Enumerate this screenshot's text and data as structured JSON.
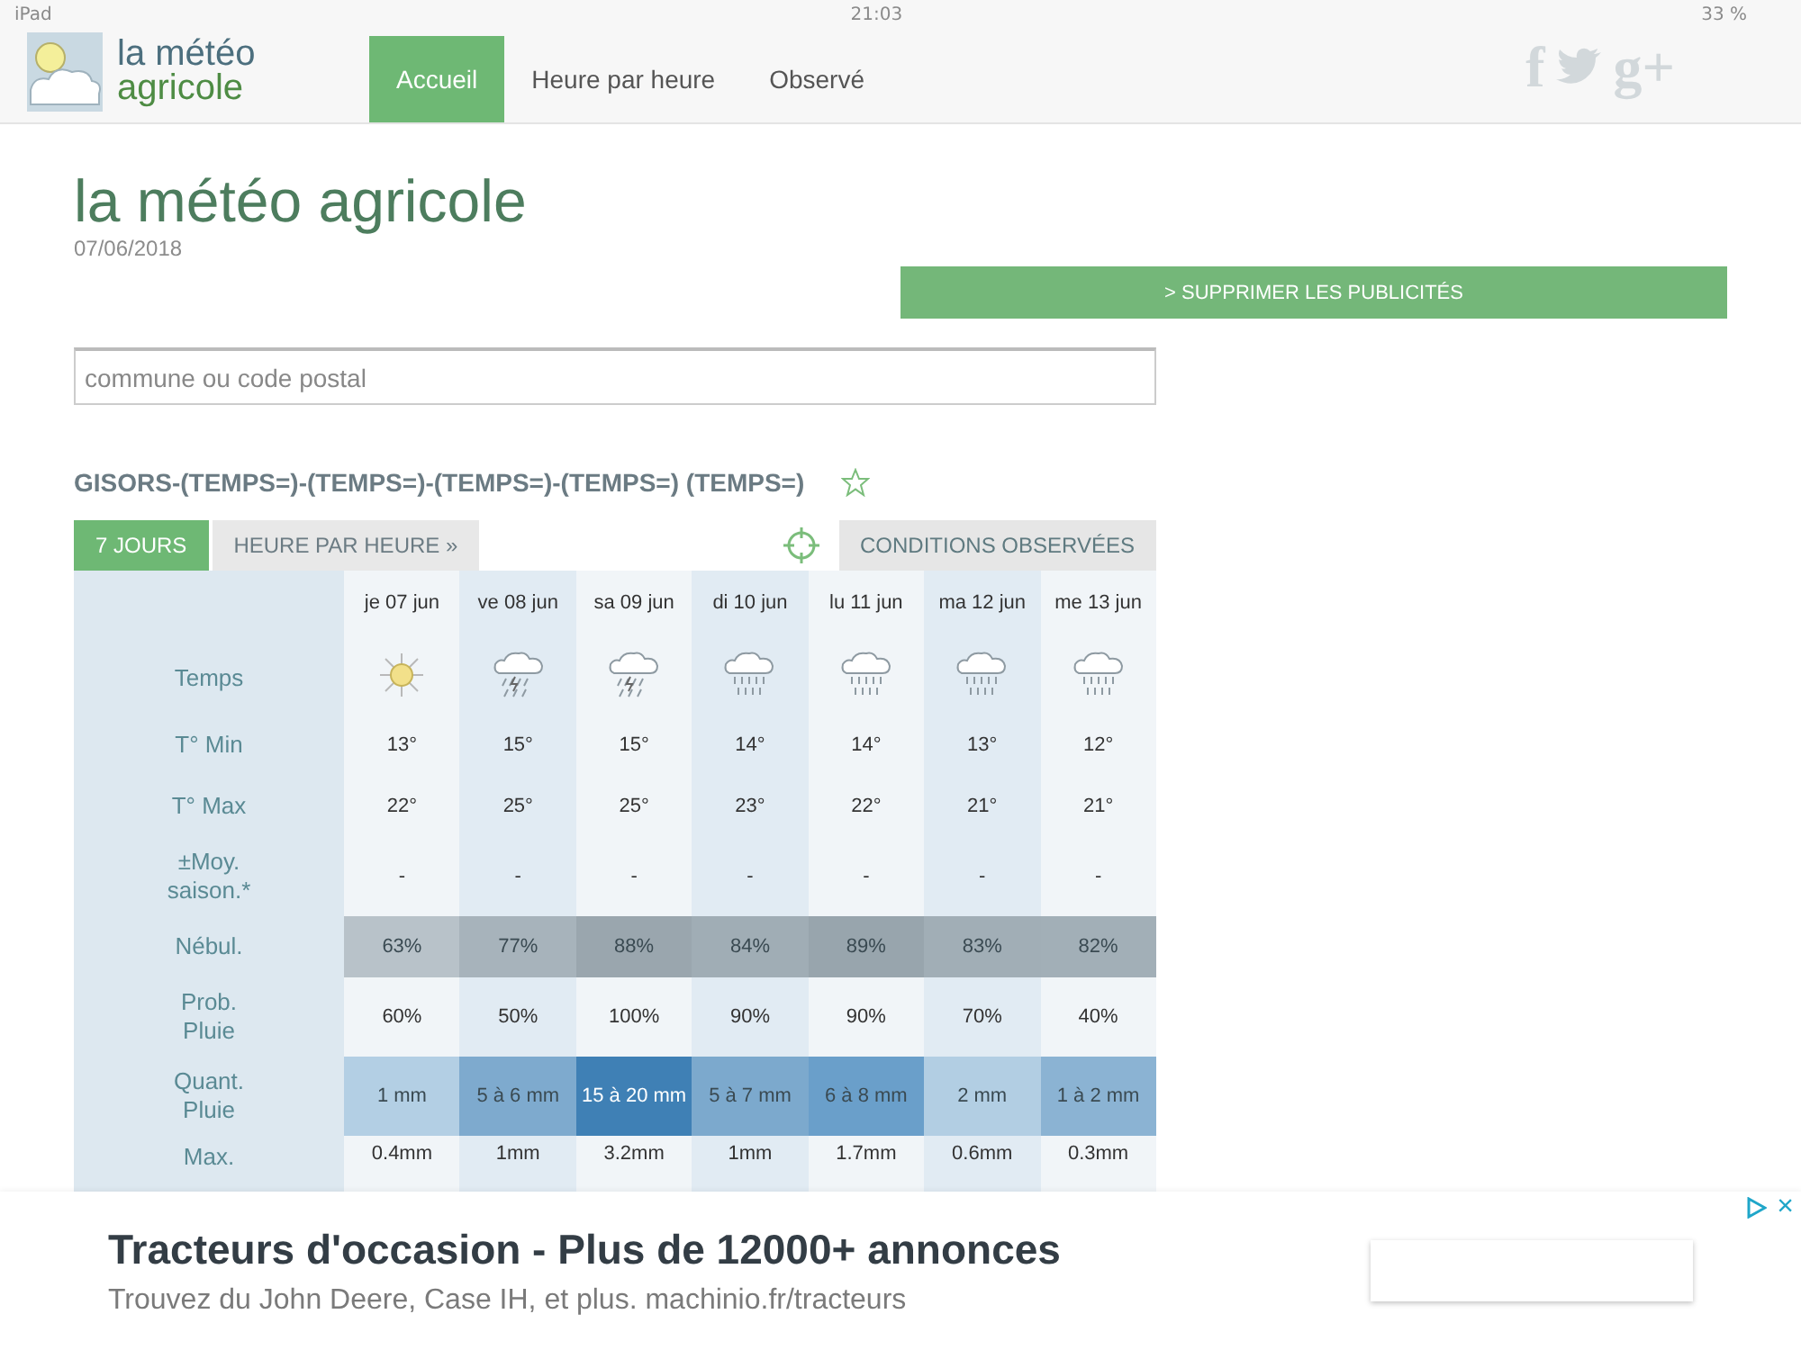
{
  "status_bar": {
    "carrier": "iPad",
    "time": "21:03",
    "battery": "33 %"
  },
  "header": {
    "logo": {
      "line_1": "la météo",
      "line_2": "agricole"
    },
    "nav": [
      {
        "label": "Accueil",
        "selected": true
      },
      {
        "label": "Heure par heure",
        "selected": false
      },
      {
        "label": "Observé",
        "selected": false
      }
    ],
    "social": [
      {
        "kind": "facebook",
        "glyph": "f"
      },
      {
        "kind": "twitter"
      },
      {
        "kind": "google",
        "glyph": "g+"
      }
    ]
  },
  "page": {
    "title": "la météo agricole",
    "date": "07/06/2018",
    "remove_ads_button": "> SUPPRIMER LES PUBLICITÉS",
    "search": {
      "placeholder": "commune ou code postal"
    }
  },
  "location": {
    "name": "GISORS-(TEMPS=)-(TEMPS=)-(TEMPS=)-(TEMPS=) (TEMPS=)",
    "favorite": false
  },
  "view_tabs": [
    {
      "label": "7 JOURS",
      "selected": true
    },
    {
      "label": "HEURE PAR HEURE »",
      "selected": false
    }
  ],
  "observed_button": "CONDITIONS OBSERVÉES",
  "forecast": {
    "weather_label": "Temps",
    "days": [
      {
        "date": "je 07 jun",
        "kind": "sun"
      },
      {
        "date": "ve 08 jun",
        "kind": "storm"
      },
      {
        "date": "sa 09 jun",
        "kind": "storm"
      },
      {
        "date": "di 10 jun",
        "kind": "rain"
      },
      {
        "date": "lu 11 jun",
        "kind": "rain"
      },
      {
        "date": "ma 12 jun",
        "kind": "rain"
      },
      {
        "date": "me 13 jun",
        "kind": "rain"
      }
    ],
    "rows": [
      {
        "kind": "plain",
        "label": "T° Min",
        "cells": [
          "13°",
          "15°",
          "15°",
          "14°",
          "14°",
          "13°",
          "12°"
        ]
      },
      {
        "kind": "plain",
        "label": "T° Max",
        "cells": [
          "22°",
          "25°",
          "25°",
          "23°",
          "22°",
          "21°",
          "21°"
        ]
      },
      {
        "kind": "plain",
        "label": "±Moy. saison.*",
        "cells": [
          "-",
          "-",
          "-",
          "-",
          "-",
          "-",
          "-"
        ]
      },
      {
        "kind": "shaded",
        "label": "Nébul.",
        "cells": [
          {
            "text": "63%",
            "color": "#b8c2c9"
          },
          {
            "text": "77%",
            "color": "#a7b3bb"
          },
          {
            "text": "88%",
            "color": "#9aa6ae"
          },
          {
            "text": "84%",
            "color": "#a0adb5"
          },
          {
            "text": "89%",
            "color": "#98a5ad"
          },
          {
            "text": "83%",
            "color": "#a1aeb6"
          },
          {
            "text": "82%",
            "color": "#a2afb7"
          }
        ]
      },
      {
        "kind": "plain",
        "label": "Prob. Pluie",
        "cells": [
          "60%",
          "50%",
          "100%",
          "90%",
          "90%",
          "70%",
          "40%"
        ]
      },
      {
        "kind": "shaded",
        "label": "Quant. Pluie",
        "cells": [
          {
            "text": "1 mm",
            "color": "#b3cfe4"
          },
          {
            "text": "5 à 6 mm",
            "color": "#7eaace"
          },
          {
            "text": "15 à 20 mm",
            "color": "#3f80b5"
          },
          {
            "text": "5 à 7 mm",
            "color": "#7ca9cd"
          },
          {
            "text": "6 à 8 mm",
            "color": "#6a9fca"
          },
          {
            "text": "2 mm",
            "color": "#b2cee3"
          },
          {
            "text": "1 à 2 mm",
            "color": "#8bb3d3"
          }
        ]
      },
      {
        "kind": "plain",
        "label": "Max.",
        "cells": [
          "0.4mm",
          "1mm",
          "3.2mm",
          "1mm",
          "1.7mm",
          "0.6mm",
          "0.3mm"
        ]
      }
    ]
  },
  "ad": {
    "title": "Tracteurs d'occasion - Plus de 12000+ annonces",
    "text": "Trouvez du John Deere, Case IH, et plus. machinio.fr/tracteurs",
    "close": "×"
  }
}
